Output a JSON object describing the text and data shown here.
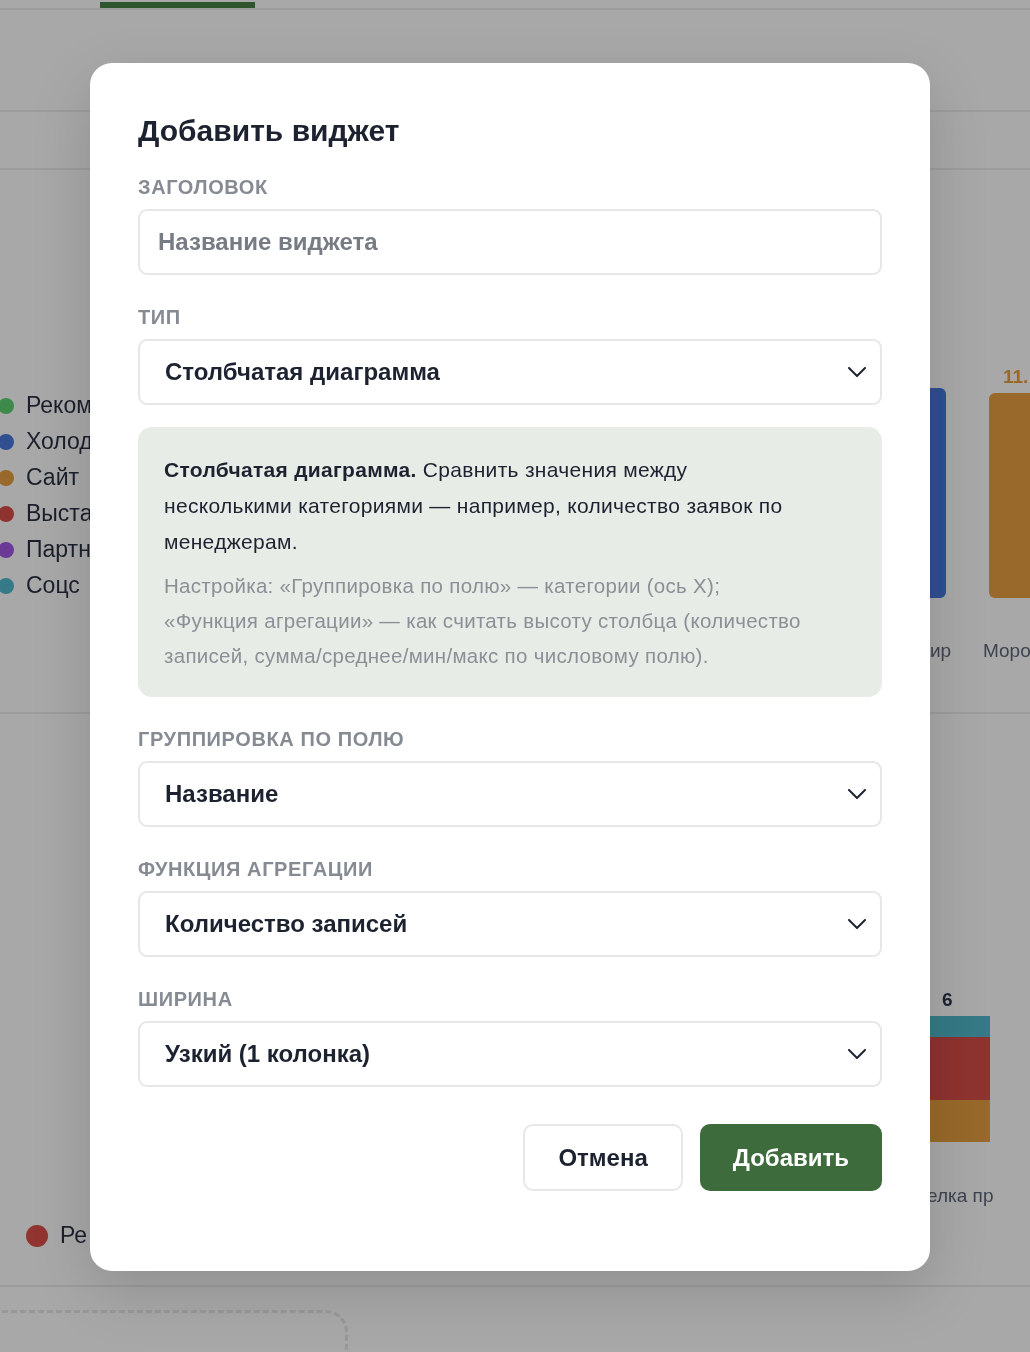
{
  "background": {
    "legend": [
      {
        "label": "Реком",
        "color": "#3d8a4b"
      },
      {
        "label": "Холод",
        "color": "#2f4f91"
      },
      {
        "label": "Сайт",
        "color": "#98692a"
      },
      {
        "label": "Выста",
        "color": "#8e3330"
      },
      {
        "label": "Партн",
        "color": "#6a3a96"
      },
      {
        "label": "Соцс",
        "color": "#357a86"
      }
    ],
    "bars": [
      {
        "category": "ир",
        "color": "#2f4f91"
      },
      {
        "category": "Моро",
        "value_label": "11.",
        "color": "#98692a"
      }
    ],
    "stacked_bar": {
      "total": "6",
      "category": "елка пр",
      "segments": [
        {
          "color": "#357a86"
        },
        {
          "color": "#8e3330"
        },
        {
          "color": "#98692a"
        }
      ]
    },
    "bottom_legend": [
      {
        "label": "Ре",
        "color": "#923530"
      }
    ]
  },
  "modal": {
    "title": "Добавить виджет",
    "fields": [
      {
        "kind": "text",
        "label": "ЗАГОЛОВОК",
        "placeholder": "Название виджета"
      },
      {
        "kind": "select",
        "label": "ТИП",
        "value": "Столбчатая диаграмма",
        "info": {
          "description": "**Столбчатая диаграмма.** Сравнить значения между несколькими категориями — например, количество заявок по менеджерам.",
          "hint": "Настройка: «Группировка по полю» — категории (ось X); «Функция агрегации» — как считать высоту столбца (количество записей, сумма/среднее/мин/макс по числовому полю)."
        }
      },
      {
        "kind": "select",
        "label": "ГРУППИРОВКА ПО ПОЛЮ",
        "value": "Название"
      },
      {
        "kind": "select",
        "label": "ФУНКЦИЯ АГРЕГАЦИИ",
        "value": "Количество записей"
      },
      {
        "kind": "select",
        "label": "ШИРИНА",
        "value": "Узкий (1 колонка)"
      }
    ],
    "buttons": [
      {
        "label": "Отмена",
        "kind": "secondary"
      },
      {
        "label": "Добавить",
        "kind": "primary"
      }
    ]
  }
}
